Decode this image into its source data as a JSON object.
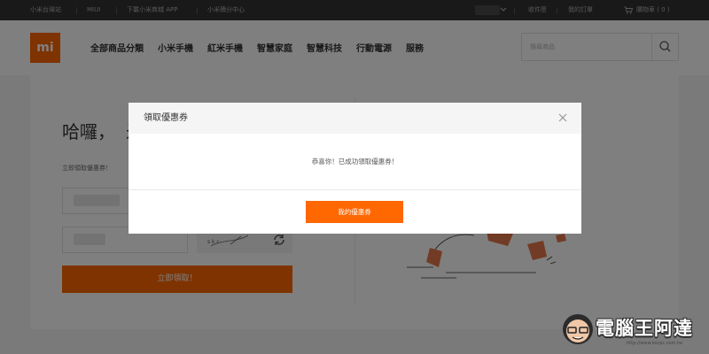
{
  "topbar": {
    "links": [
      "小米台灣站",
      "MIUI",
      "下載小米商城 APP",
      "小米積分中心"
    ],
    "right_links": [
      "收件匣",
      "我的訂單"
    ],
    "cart_label": "購物車 ( 0 )"
  },
  "header": {
    "logo_text": "mi",
    "nav": [
      "全部商品分類",
      "小米手機",
      "紅米手機",
      "智慧家庭",
      "智慧科技",
      "行動電源",
      "服務"
    ],
    "search_placeholder": "搜尋商品"
  },
  "page": {
    "greeting": "哈囉，",
    "greeting_cut": "米",
    "subtitle": "立即領取優惠券！",
    "captcha_chars": "s  k  c",
    "submit_label": "立即領取！"
  },
  "modal": {
    "title": "領取優惠券",
    "message": "恭喜你！已成功領取優惠券！",
    "button_label": "我的優惠券"
  },
  "watermark": {
    "text": "電腦王阿達",
    "url": "http://www.kocpc.com.tw"
  },
  "colors": {
    "accent": "#ff6700",
    "topbar": "#333333",
    "overlay": "rgba(0,0,0,0.5)"
  }
}
